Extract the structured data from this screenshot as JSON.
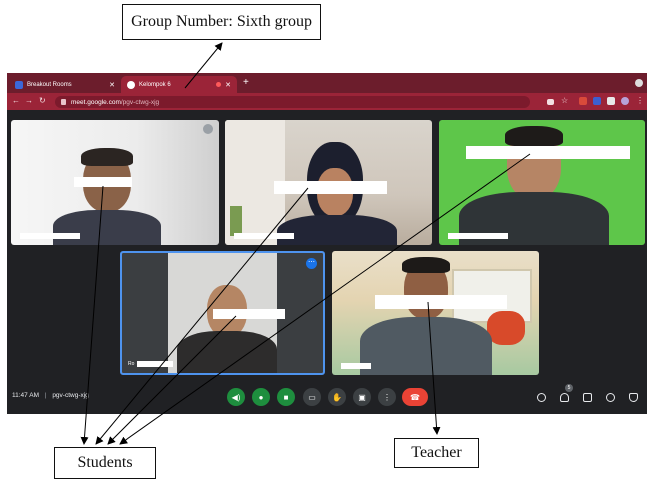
{
  "annotations": {
    "group_label": "Group Number: Sixth group",
    "students_label": "Students",
    "teacher_label": "Teacher"
  },
  "browser": {
    "tabs": [
      {
        "label": "Breakout Rooms"
      },
      {
        "label": "Kelompok 6"
      }
    ],
    "url_host": "meet.google.com",
    "url_path": "/pgv-ctwg-xjg",
    "accent_color": "#9b2438"
  },
  "meeting": {
    "time": "11:47 AM",
    "code": "pgv-ctwg-xjg",
    "participants_badge": "5",
    "tiles": [
      {
        "name": "",
        "highlighted": false
      },
      {
        "name": "",
        "highlighted": false
      },
      {
        "name": "",
        "highlighted": false
      },
      {
        "name": "Ro",
        "highlighted": true
      },
      {
        "name": "",
        "highlighted": false
      }
    ],
    "controls": [
      "audio-output",
      "microphone",
      "camera",
      "captions",
      "raise-hand",
      "present",
      "more-options",
      "leave-call"
    ],
    "right_controls": [
      "info",
      "people",
      "chat",
      "activities",
      "host-controls"
    ]
  },
  "colors": {
    "control_green": "#1e8e3e",
    "control_grey": "#3c4043",
    "leave_red": "#ea4335",
    "active_speaker_border": "#4e93ee"
  }
}
